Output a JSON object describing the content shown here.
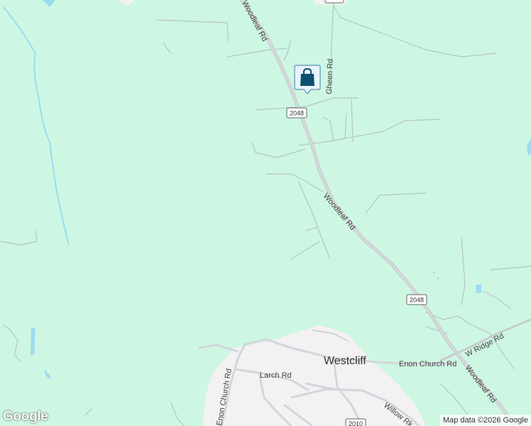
{
  "map": {
    "colors": {
      "land": "#cdf7e2",
      "water": "#9ddbf0",
      "urban": "#f3f0f0",
      "major_road": "#c7cbd0",
      "minor_road": "#aeb9bd",
      "marker": "#0d4f6e"
    },
    "roads": {
      "woodleaf_top": "Woodleaf Rd",
      "woodleaf_mid": "Woodleaf Rd",
      "woodleaf_bottom": "Woodleaf Rd",
      "gheen": "Gheen Rd",
      "enon_church_east": "Enon Church Rd",
      "enon_church_south": "Enon Church Rd",
      "larch": "Larch Rd",
      "w_ridge": "W Ridge Rd",
      "willow": "Willow Rk"
    },
    "shields": {
      "upper": "2048",
      "middle": "2048",
      "bottom": "2010"
    },
    "places": {
      "westcliff": "Westcliff"
    },
    "marker": {
      "icon": "shopping-bag-icon"
    },
    "branding": {
      "logo": "Google",
      "attribution": "Map data ©2026 Google"
    }
  }
}
